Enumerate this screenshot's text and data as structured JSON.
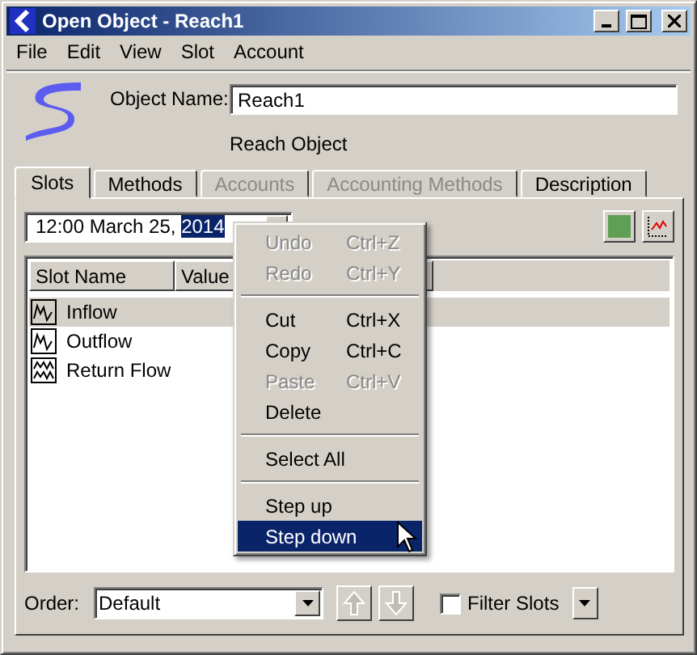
{
  "window": {
    "title": "Open Object - Reach1"
  },
  "menu": [
    "File",
    "Edit",
    "View",
    "Slot",
    "Account"
  ],
  "object": {
    "label": "Object Name:",
    "value": "Reach1",
    "type": "Reach Object"
  },
  "tabs": [
    {
      "label": "Slots",
      "selected": true,
      "disabled": false
    },
    {
      "label": "Methods",
      "selected": false,
      "disabled": false
    },
    {
      "label": "Accounts",
      "selected": false,
      "disabled": true
    },
    {
      "label": "Accounting Methods",
      "selected": false,
      "disabled": true
    },
    {
      "label": "Description",
      "selected": false,
      "disabled": false
    }
  ],
  "date": {
    "value": "12:00 March 25, ",
    "highlighted": "2014"
  },
  "table": {
    "columns": [
      "Slot Name",
      "Value"
    ],
    "rows": [
      {
        "name": "Inflow",
        "kind": "series",
        "selected": true
      },
      {
        "name": "Outflow",
        "kind": "series",
        "selected": false
      },
      {
        "name": "Return Flow",
        "kind": "multi",
        "selected": false
      }
    ]
  },
  "context_menu": [
    {
      "kind": "item",
      "label": "Undo",
      "shortcut": "Ctrl+Z",
      "disabled": true,
      "selected": false
    },
    {
      "kind": "item",
      "label": "Redo",
      "shortcut": "Ctrl+Y",
      "disabled": true,
      "selected": false
    },
    {
      "kind": "separator"
    },
    {
      "kind": "item",
      "label": "Cut",
      "shortcut": "Ctrl+X",
      "disabled": false,
      "selected": false
    },
    {
      "kind": "item",
      "label": "Copy",
      "shortcut": "Ctrl+C",
      "disabled": false,
      "selected": false
    },
    {
      "kind": "item",
      "label": "Paste",
      "shortcut": "Ctrl+V",
      "disabled": true,
      "selected": false
    },
    {
      "kind": "item",
      "label": "Delete",
      "disabled": false,
      "selected": false
    },
    {
      "kind": "separator"
    },
    {
      "kind": "item",
      "label": "Select All",
      "disabled": false,
      "selected": false
    },
    {
      "kind": "separator"
    },
    {
      "kind": "item",
      "label": "Step up",
      "disabled": false,
      "selected": false
    },
    {
      "kind": "item",
      "label": "Step down",
      "disabled": false,
      "selected": true
    }
  ],
  "bottom": {
    "order_label": "Order:",
    "order_value": "Default",
    "up_disabled": true,
    "down_disabled": true,
    "filter": {
      "label": "Filter Slots",
      "checked": false
    }
  }
}
